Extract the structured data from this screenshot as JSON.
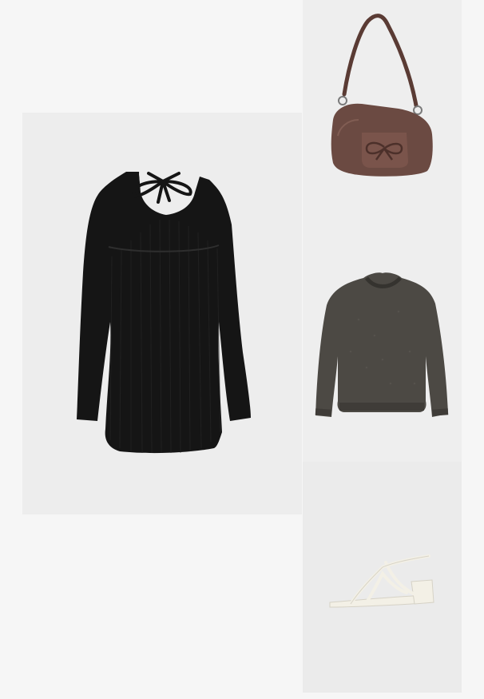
{
  "outfit": {
    "items": [
      {
        "icon": "dress-icon",
        "background": "#ededed",
        "color": "#151515"
      },
      {
        "icon": "handbag-icon",
        "background": "#eeeeee",
        "color": "#6b4a42"
      },
      {
        "icon": "sweater-icon",
        "background": "#eeeeee",
        "color": "#4c4944"
      },
      {
        "icon": "sandal-icon",
        "background": "#ebebeb",
        "color": "#f3f0e6"
      }
    ]
  },
  "colors": {
    "page_background": "#f6f6f6"
  }
}
